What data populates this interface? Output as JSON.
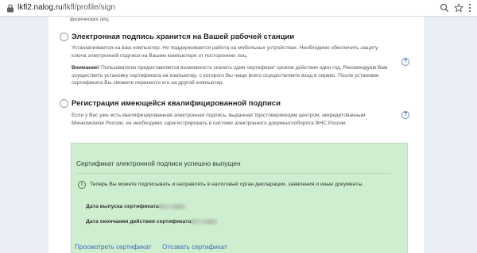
{
  "browser": {
    "url_host": "lkfl2.nalog.ru",
    "url_path": "/lkfl/profile/sign"
  },
  "page": {
    "top_fragment": "физических лиц."
  },
  "option_workstation": {
    "title": "Электронная подпись хранится на Вашей рабочей станции",
    "line1": "Устанавливается на ваш компьютер. Не поддерживается работа на мобильных устройствах. Необходимо обеспечить защиту",
    "line2": "ключа электронной подписи на Вашем компьютере от посторонних лиц.",
    "warning_label": "Внимание!",
    "warning_line1": " Пользователю предоставляется возможность скачать один сертификат сроком действия один год. Рекомендуем Вам",
    "warning_line2": "осуществить установку сертификата на компьютер, с которого Вы чаще всего осуществляете вход в сервис. После установки",
    "warning_line3": "сертификата Вы сможете перенести его на другой компьютер.",
    "help": "?"
  },
  "option_qualified": {
    "title": "Регистрация имеющейся квалифицированной подписи",
    "line1": "Если у Вас уже есть квалифицированная электронная подпись, выданная Удостоверяющим центром, аккредитованным",
    "line2": "Минкомсвязи России, ее необходимо зарегистрировать в системе электронного документооборота ФНС России.",
    "help": "?"
  },
  "success_panel": {
    "title": "Сертификат электронной подписи успешно выпущен",
    "info_icon": "i",
    "info_text": "Теперь Вы можете подписывать и направлять в налоговый орган декларации, заявления и иные документы.",
    "issue_date_label": "Дата выпуска сертификата:",
    "expiry_date_label": "Дата окончания действия сертификата:",
    "view_link": "Просмотреть сертификат",
    "revoke_link": "Отозвать сертификат"
  },
  "colors": {
    "panel_bg": "#cfeecf",
    "link": "#3a6fc1",
    "page_side": "#e9eef7"
  }
}
